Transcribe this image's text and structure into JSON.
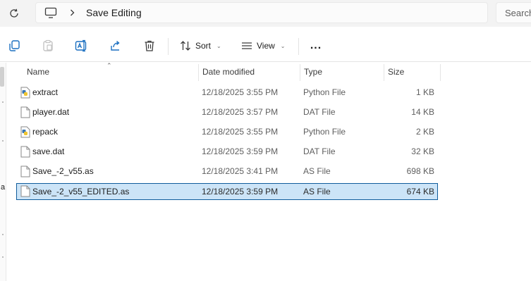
{
  "address": {
    "breadcrumb": "Save Editing"
  },
  "search": {
    "placeholder": "Search"
  },
  "toolbar": {
    "sort_label": "Sort",
    "view_label": "View",
    "more_label": "..."
  },
  "nav": {
    "clipped_text": "a"
  },
  "columns": {
    "name": "Name",
    "date": "Date modified",
    "type": "Type",
    "size": "Size"
  },
  "files": [
    {
      "name": "extract",
      "date": "12/18/2025 3:55 PM",
      "type": "Python File",
      "size": "1 KB",
      "icon": "python-file-icon",
      "selected": false
    },
    {
      "name": "player.dat",
      "date": "12/18/2025 3:57 PM",
      "type": "DAT File",
      "size": "14 KB",
      "icon": "document-file-icon",
      "selected": false
    },
    {
      "name": "repack",
      "date": "12/18/2025 3:55 PM",
      "type": "Python File",
      "size": "2 KB",
      "icon": "python-file-icon",
      "selected": false
    },
    {
      "name": "save.dat",
      "date": "12/18/2025 3:59 PM",
      "type": "DAT File",
      "size": "32 KB",
      "icon": "document-file-icon",
      "selected": false
    },
    {
      "name": "Save_-2_v55.as",
      "date": "12/18/2025 3:41 PM",
      "type": "AS File",
      "size": "698 KB",
      "icon": "document-file-icon",
      "selected": false
    },
    {
      "name": "Save_-2_v55_EDITED.as",
      "date": "12/18/2025 3:59 PM",
      "type": "AS File",
      "size": "674 KB",
      "icon": "document-file-icon",
      "selected": true
    }
  ],
  "colors": {
    "selection_bg": "#cce4f7",
    "selection_border": "#0f5c9c",
    "accent": "#1a6fc1"
  }
}
